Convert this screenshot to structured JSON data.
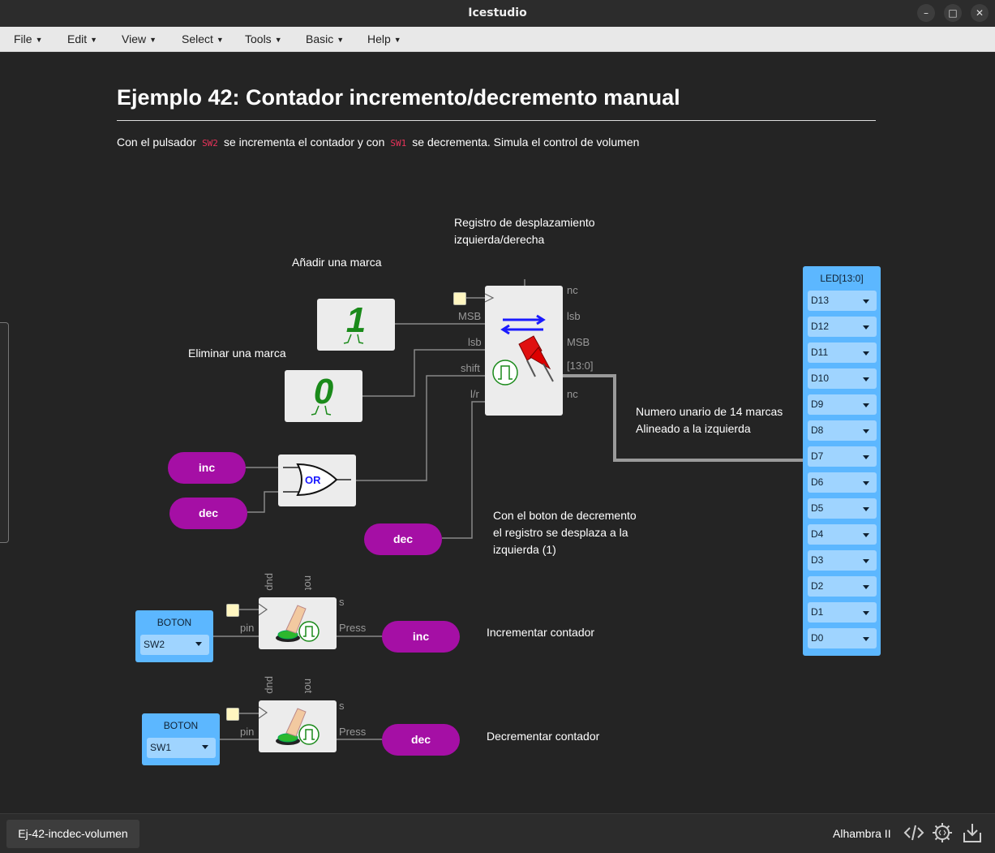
{
  "window": {
    "title": "Icestudio",
    "minimize": "–",
    "maximize": "□",
    "close": "✕"
  },
  "menu": [
    "File",
    "Edit",
    "View",
    "Select",
    "Tools",
    "Basic",
    "Help"
  ],
  "heading": "Ejemplo 42: Contador incremento/decremento manual",
  "description": {
    "part1": "Con el pulsador",
    "code1": "SW2",
    "part2": "se incrementa el contador y con",
    "code2": "SW1",
    "part3": "se decrementa. Simula el control de volumen"
  },
  "notes": {
    "register_line1": "Registro de desplazamiento",
    "register_line2": "izquierda/derecha",
    "add_mark": "Añadir una marca",
    "remove_mark": "Eliminar una marca",
    "unary_line1": "Numero unario de 14 marcas",
    "unary_line2": "Alineado a la izquierda",
    "dec_line1": "Con el boton de decremento",
    "dec_line2": "el registro se desplaza a la",
    "dec_line3": "izquierda (1)",
    "inc_counter": "Incrementar contador",
    "dec_counter": "Decrementar contador"
  },
  "constants": {
    "one": "1",
    "zero": "0"
  },
  "or_gate": {
    "label": "OR"
  },
  "shift_register": {
    "inputs": [
      "MSB",
      "lsb",
      "shift",
      "l/r"
    ],
    "outputs": [
      "nc",
      "lsb",
      "MSB",
      "[13:0]",
      "nc"
    ]
  },
  "button_block": {
    "params": [
      "pup",
      "not"
    ],
    "input": "pin",
    "outputs": [
      "s",
      "Press"
    ]
  },
  "labels": {
    "inc": "inc",
    "dec": "dec"
  },
  "buttons": [
    {
      "title": "BOTON",
      "value": "SW2"
    },
    {
      "title": "BOTON",
      "value": "SW1"
    }
  ],
  "led": {
    "title": "LED[13:0]",
    "pins": [
      "D13",
      "D12",
      "D11",
      "D10",
      "D9",
      "D8",
      "D7",
      "D6",
      "D5",
      "D4",
      "D3",
      "D2",
      "D1",
      "D0"
    ]
  },
  "status": {
    "file": "Ej-42-incdec-volumen",
    "board": "Alhambra II"
  },
  "colors": {
    "label_pill": "#a50fa5",
    "io_block": "#5cb7ff",
    "wire": "#888888",
    "bus": "#9a9a9a"
  }
}
